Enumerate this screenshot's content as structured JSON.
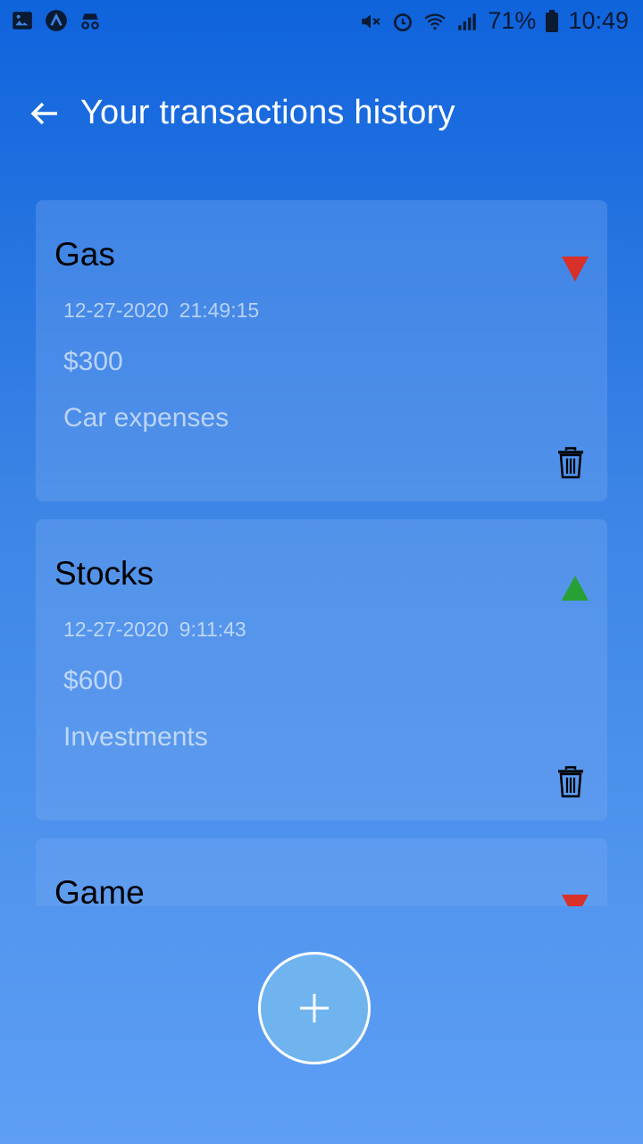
{
  "status_bar": {
    "battery": "71%",
    "time": "10:49",
    "icons_left": [
      "gallery-icon",
      "app-a-icon",
      "incognito-icon"
    ],
    "icons_right": [
      "mute-icon",
      "alarm-icon",
      "wifi-icon",
      "signal-icon",
      "battery-icon"
    ]
  },
  "header": {
    "title": "Your transactions history",
    "back_icon": "arrow-left-icon"
  },
  "colors": {
    "expense": "#d9302a",
    "income": "#27a035"
  },
  "transactions": [
    {
      "name": "Gas",
      "date": "12-27-2020",
      "time": "21:49:15",
      "amount": "$300",
      "category": "Car expenses",
      "direction": "down"
    },
    {
      "name": "Stocks",
      "date": "12-27-2020",
      "time": "9:11:43",
      "amount": "$600",
      "category": "Investments",
      "direction": "up"
    },
    {
      "name": "Game",
      "date": "",
      "time": "",
      "amount": "",
      "category": "",
      "direction": "down"
    }
  ],
  "fab": {
    "icon": "plus-icon"
  }
}
